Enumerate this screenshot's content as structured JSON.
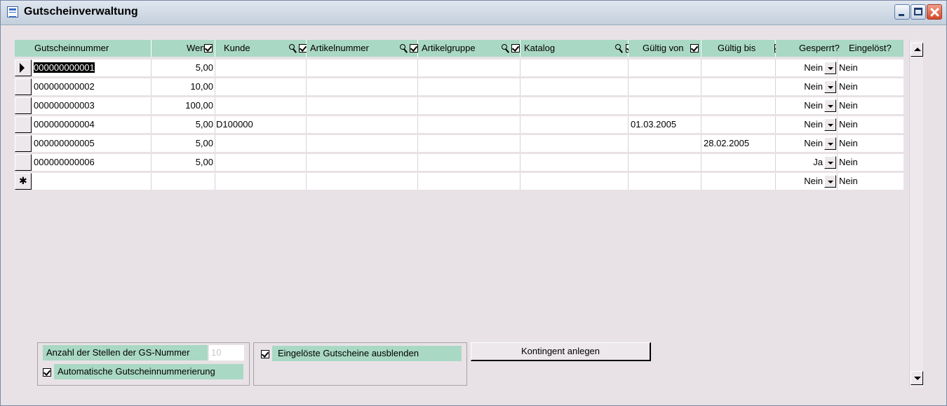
{
  "window": {
    "title": "Gutscheinverwaltung"
  },
  "grid": {
    "headers": {
      "gutscheinnummer": "Gutscheinnummer",
      "wert": "Wert",
      "kunde": "Kunde",
      "artikelnummer": "Artikelnummer",
      "artikelgruppe": "Artikelgruppe",
      "katalog": "Katalog",
      "gueltig_von": "Gültig von",
      "gueltig_bis": "Gültig bis",
      "gesperrt": "Gesperrt?",
      "eingeloest": "Eingelöst?"
    },
    "rows": [
      {
        "nummer": "000000000001",
        "wert": "5,00",
        "kunde": "",
        "artikelnummer": "",
        "artikelgruppe": "",
        "katalog": "",
        "gueltig_von": "",
        "gueltig_bis": "",
        "gesperrt": "Nein",
        "eingeloest": "Nein"
      },
      {
        "nummer": "000000000002",
        "wert": "10,00",
        "kunde": "",
        "artikelnummer": "",
        "artikelgruppe": "",
        "katalog": "",
        "gueltig_von": "",
        "gueltig_bis": "",
        "gesperrt": "Nein",
        "eingeloest": "Nein"
      },
      {
        "nummer": "000000000003",
        "wert": "100,00",
        "kunde": "",
        "artikelnummer": "",
        "artikelgruppe": "",
        "katalog": "",
        "gueltig_von": "",
        "gueltig_bis": "",
        "gesperrt": "Nein",
        "eingeloest": "Nein"
      },
      {
        "nummer": "000000000004",
        "wert": "5,00",
        "kunde": "D100000",
        "artikelnummer": "",
        "artikelgruppe": "",
        "katalog": "",
        "gueltig_von": "01.03.2005",
        "gueltig_bis": "",
        "gesperrt": "Nein",
        "eingeloest": "Nein"
      },
      {
        "nummer": "000000000005",
        "wert": "5,00",
        "kunde": "",
        "artikelnummer": "",
        "artikelgruppe": "",
        "katalog": "",
        "gueltig_von": "",
        "gueltig_bis": "28.02.2005",
        "gesperrt": "Nein",
        "eingeloest": "Nein"
      },
      {
        "nummer": "000000000006",
        "wert": "5,00",
        "kunde": "",
        "artikelnummer": "",
        "artikelgruppe": "",
        "katalog": "",
        "gueltig_von": "",
        "gueltig_bis": "",
        "gesperrt": "Ja",
        "eingeloest": "Nein"
      }
    ],
    "new_row": {
      "gesperrt": "Nein",
      "eingeloest": "Nein"
    }
  },
  "options": {
    "anzahl_label": "Anzahl der Stellen der GS-Nummer",
    "anzahl_value": "10",
    "auto_label": "Automatische Gutscheinnummerierung",
    "ausblenden_label": "Eingelöste Gutscheine ausblenden",
    "kontingent_button": "Kontingent anlegen"
  }
}
